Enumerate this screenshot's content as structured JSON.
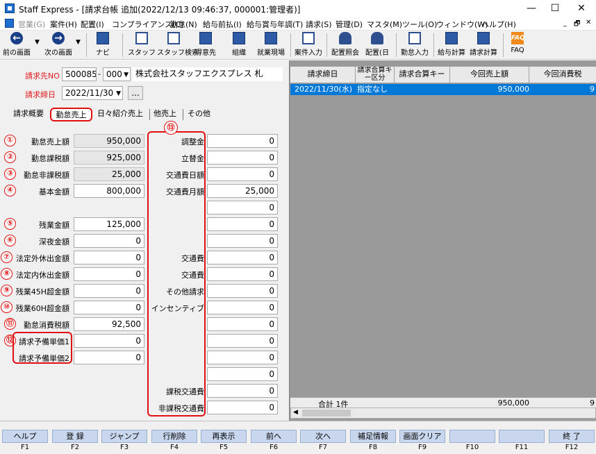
{
  "window": {
    "title": "Staff Express - [請求台帳 追加(2022/12/13 09:46:37, 000001:管理者)]",
    "min": "—",
    "max": "☐",
    "close": "✕"
  },
  "menu": [
    "営業(G)",
    "案件(H)",
    "配置(I)",
    "コンプライアンス(C)",
    "勤怠(N)",
    "給与前払(I)",
    "給与賞与年調(T)",
    "請求(S)",
    "管理(D)",
    "マスタ(M)",
    "ツール(O)",
    "ウィンドウ(W)",
    "ヘルプ(H)"
  ],
  "mdi": {
    "min": "_",
    "restore": "🗗",
    "close": "✕"
  },
  "toolbar": {
    "prev": "前の画面",
    "next": "次の画面",
    "navi": "ナビ",
    "staff": "スタッフ",
    "staff_search": "スタッフ検索",
    "client": "得意先",
    "org": "組織",
    "site": "就業現場",
    "case_input": "案件入力",
    "assign_inquiry": "配置照会",
    "assign_day": "配置(日",
    "attend_input": "勤怠入力",
    "salary_calc": "給与計算",
    "billing_calc": "請求計算",
    "faq": "FAQ",
    "faq_logo": "FAQ"
  },
  "header": {
    "billing_no_label": "請求先NO",
    "billing_no": "500085",
    "dash": "-",
    "billing_sub": "000",
    "company": "株式会社スタッフエクスプレス 札",
    "close_date_label": "請求締日",
    "close_date": "2022/11/30",
    "ellipsis": "..."
  },
  "tabs": [
    "請求概要",
    "勤怠売上",
    "日々紹介売上",
    "他売上",
    "その他"
  ],
  "left_fields": [
    {
      "badge": "①",
      "label": "勤怠売上額",
      "value": "950,000"
    },
    {
      "badge": "②",
      "label": "勤怠課税額",
      "value": "925,000"
    },
    {
      "badge": "③",
      "label": "勤怠非課税額",
      "value": "25,000"
    },
    {
      "badge": "④",
      "label": "基本金額",
      "value": "800,000"
    },
    {
      "badge": "⑤",
      "label": "残業金額",
      "value": "125,000"
    },
    {
      "badge": "⑥",
      "label": "深夜金額",
      "value": "0"
    },
    {
      "badge": "⑦",
      "label": "法定外休出金額",
      "value": "0"
    },
    {
      "badge": "⑧",
      "label": "法定内休出金額",
      "value": "0"
    },
    {
      "badge": "⑨",
      "label": "残業45H超金額",
      "value": "0"
    },
    {
      "badge": "⑩",
      "label": "残業60H超金額",
      "value": "0"
    },
    {
      "badge": "⑪",
      "label": "勤怠消費税額",
      "value": "92,500"
    },
    {
      "badge": "⑫",
      "label": "請求予備単価1",
      "value": "0"
    },
    {
      "badge": "",
      "label": "請求予備単価2",
      "value": "0"
    }
  ],
  "right_badge": "⑬",
  "right_fields": [
    {
      "label": "調整金",
      "value": "0"
    },
    {
      "label": "立替金",
      "value": "0"
    },
    {
      "label": "交通費日額",
      "value": "0"
    },
    {
      "label": "交通費月額",
      "value": "25,000"
    },
    {
      "label": "",
      "value": "0"
    },
    {
      "label": "",
      "value": "0"
    },
    {
      "label": "",
      "value": "0"
    },
    {
      "label": "交通費",
      "value": "0"
    },
    {
      "label": "交通費",
      "value": "0"
    },
    {
      "label": "その他請求",
      "value": "0"
    },
    {
      "label": "インセンティブ",
      "value": "0"
    },
    {
      "label": "",
      "value": "0"
    },
    {
      "label": "",
      "value": "0"
    },
    {
      "label": "",
      "value": "0"
    },
    {
      "label": "",
      "value": "0"
    },
    {
      "label": "課税交通費",
      "value": "0"
    },
    {
      "label": "非課税交通費",
      "value": "0"
    }
  ],
  "grid": {
    "headers": [
      "請求締日",
      "請求合算キー区分",
      "請求合算キー",
      "今回売上額",
      "今回消費税"
    ],
    "row": [
      "2022/11/30(水)",
      "指定なし",
      "",
      "950,000",
      "9"
    ],
    "total_label": "合計 1件",
    "total_sales": "950,000",
    "total_tax": "9"
  },
  "fkeys": [
    {
      "label": "ヘルプ",
      "key": "F1"
    },
    {
      "label": "登 録",
      "key": "F2"
    },
    {
      "label": "ジャンプ",
      "key": "F3"
    },
    {
      "label": "行削除",
      "key": "F4"
    },
    {
      "label": "再表示",
      "key": "F5"
    },
    {
      "label": "前へ",
      "key": "F6"
    },
    {
      "label": "次へ",
      "key": "F7"
    },
    {
      "label": "補足情報",
      "key": "F8"
    },
    {
      "label": "画面クリア",
      "key": "F9"
    },
    {
      "label": "",
      "key": "F10"
    },
    {
      "label": "",
      "key": "F11"
    },
    {
      "label": "終 了",
      "key": "F12"
    }
  ],
  "colors": {
    "accent_red": "#e01010",
    "selected_row": "#0078d7",
    "fkey_bg": "#c9d7ee"
  }
}
